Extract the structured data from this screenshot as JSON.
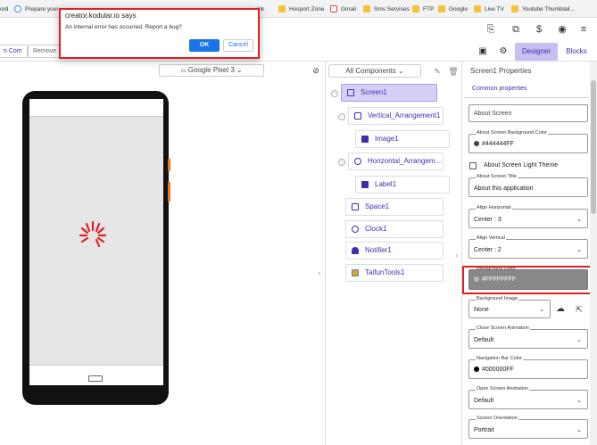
{
  "bookmarks": [
    {
      "label": "ord",
      "icon": "folder-icon"
    },
    {
      "label": "Prepare your",
      "icon": "google-icon"
    },
    {
      "label": "ink",
      "icon": "folder-icon"
    },
    {
      "label": "Hosport Zone",
      "icon": "folder-icon"
    },
    {
      "label": "Gmail",
      "icon": "gmail-icon"
    },
    {
      "label": "Sms Servises",
      "icon": "folder-icon"
    },
    {
      "label": "FTP",
      "icon": "folder-icon"
    },
    {
      "label": "Google",
      "icon": "folder-icon"
    },
    {
      "label": "Live TV",
      "icon": "folder-icon"
    },
    {
      "label": "Youtube Thumblail...",
      "icon": "folder-icon"
    }
  ],
  "toolbar": {
    "left_button": "n Com",
    "remove_button": "Remove",
    "designer_tab": "Designer",
    "blocks_tab": "Blocks"
  },
  "viewer": {
    "device": "Google Pixel 3"
  },
  "tree": {
    "filter_label": "All Components",
    "nodes": [
      {
        "label": "Screen1"
      },
      {
        "label": "Vertical_Arrangement1"
      },
      {
        "label": "Image1"
      },
      {
        "label": "Horizontal_Arrangem..."
      },
      {
        "label": "Label1"
      },
      {
        "label": "Space1"
      },
      {
        "label": "Clock1"
      },
      {
        "label": "Notifier1"
      },
      {
        "label": "TaifunTools1"
      }
    ]
  },
  "properties": {
    "title": "Screen1 Properties",
    "section": "Common properties",
    "about_screen_placeholder": "About Screen",
    "bg_color_label": "About Screen Background Color",
    "bg_color_value": "#444444FF",
    "light_theme_label": "About Screen Light Theme",
    "screen_title_label": "About Screen Title",
    "screen_title_value": "About this application",
    "align_h_label": "Align Horizontal",
    "align_h_value": "Center : 3",
    "align_v_label": "Align Vertical",
    "align_v_value": "Center : 2",
    "background_color_label": "Background Color",
    "background_color_value": "#FFFFFFFF",
    "background_image_label": "Background Image",
    "background_image_value": "None",
    "close_anim_label": "Close Screen Animation",
    "close_anim_value": "Default",
    "navbar_color_label": "Navigation Bar Color",
    "navbar_color_value": "#000000FF",
    "open_anim_label": "Open Screen Animation",
    "open_anim_value": "Default",
    "orientation_label": "Screen Orientation",
    "orientation_value": "Portrait"
  },
  "dialog": {
    "title": "creator.kodular.io says",
    "message": "An internal error has occurred. Report a bug?",
    "ok": "OK",
    "cancel": "Cancel"
  },
  "colors": {
    "accent": "#3d2fb0",
    "highlight_red": "#e02020",
    "ok_blue": "#1a73e8",
    "spinner_red": "#e02020"
  }
}
